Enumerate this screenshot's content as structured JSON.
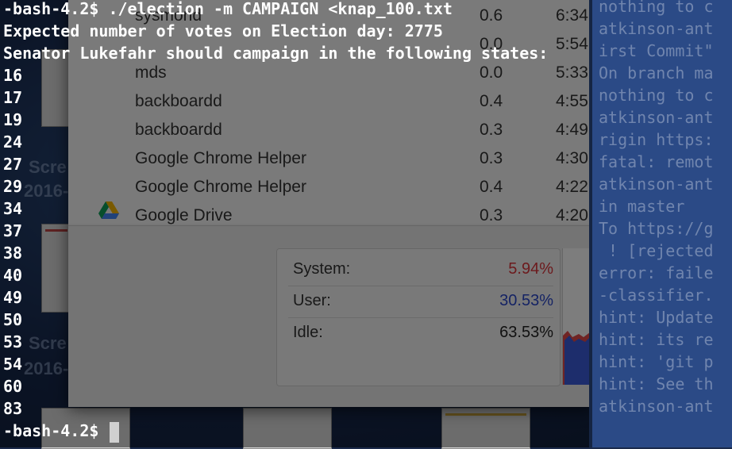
{
  "desktop": {
    "labels": [
      "Scre",
      "2016-11",
      "Scre",
      "2016-11"
    ]
  },
  "activity_monitor": {
    "rows": [
      {
        "name": "sysmond",
        "cpu": "0.6",
        "time": "6:34"
      },
      {
        "name": "",
        "cpu": "0.0",
        "time": "5:54"
      },
      {
        "name": "mds",
        "cpu": "0.0",
        "time": "5:33"
      },
      {
        "name": "backboardd",
        "cpu": "0.4",
        "time": "4:55"
      },
      {
        "name": "backboardd",
        "cpu": "0.3",
        "time": "4:49"
      },
      {
        "name": "Google Chrome Helper",
        "cpu": "0.3",
        "time": "4:30"
      },
      {
        "name": "Google Chrome Helper",
        "cpu": "0.4",
        "time": "4:22"
      },
      {
        "name": "Google Drive",
        "cpu": "0.3",
        "time": "4:20"
      }
    ],
    "stats": {
      "system_label": "System:",
      "system_value": "5.94%",
      "user_label": "User:",
      "user_value": "30.53%",
      "idle_label": "Idle:",
      "idle_value": "63.53%"
    },
    "colors": {
      "system": "#d9343a",
      "user": "#2a47c9",
      "idle": "#222222"
    }
  },
  "terminal": {
    "lines": [
      "-bash-4.2$ ./election -m CAMPAIGN <knap_100.txt",
      "Expected number of votes on Election day: 2775",
      "Senator Lukefahr should campaign in the following states:",
      "16",
      "17",
      "19",
      "24",
      "27",
      "29",
      "34",
      "37",
      "38",
      "40",
      "49",
      "50",
      "53",
      "54",
      "60",
      "83"
    ],
    "prompt": "-bash-4.2$ "
  },
  "terminal_right": {
    "lines": [
      "nothing to c",
      "atkinson-ant",
      "irst Commit\"",
      "On branch ma",
      "nothing to c",
      "atkinson-ant",
      "rigin https:",
      "fatal: remot",
      "atkinson-ant",
      "in master",
      "To https://g",
      " ! [rejected",
      "error: faile",
      "-classifier.",
      "hint: Update",
      "hint: its re",
      "hint: 'git p",
      "hint: See th",
      "atkinson-ant"
    ]
  }
}
